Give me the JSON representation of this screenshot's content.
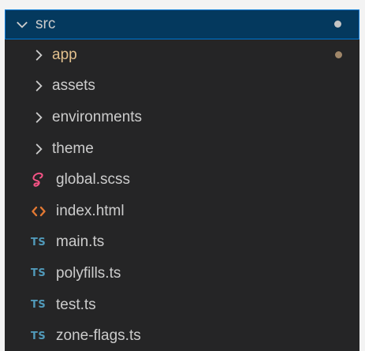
{
  "explorer": {
    "root": {
      "label": "src",
      "expanded": true,
      "status_dot_color": "#c5c5c5",
      "chevron_icon": "chevron-down-icon"
    },
    "items": [
      {
        "label": "app",
        "kind": "folder",
        "modified": true,
        "status_dot_color": "#a08769",
        "label_color": "#e2c08d",
        "icon": "chevron-right-icon"
      },
      {
        "label": "assets",
        "kind": "folder",
        "icon": "chevron-right-icon"
      },
      {
        "label": "environments",
        "kind": "folder",
        "icon": "chevron-right-icon"
      },
      {
        "label": "theme",
        "kind": "folder",
        "icon": "chevron-right-icon"
      },
      {
        "label": "global.scss",
        "kind": "file",
        "icon": "sass-file-icon",
        "icon_color": "#f55385"
      },
      {
        "label": "index.html",
        "kind": "file",
        "icon": "html-file-icon",
        "icon_color": "#e37933"
      },
      {
        "label": "main.ts",
        "kind": "file",
        "icon": "typescript-file-icon",
        "icon_text": "TS",
        "icon_color": "#519aba"
      },
      {
        "label": "polyfills.ts",
        "kind": "file",
        "icon": "typescript-file-icon",
        "icon_text": "TS",
        "icon_color": "#519aba"
      },
      {
        "label": "test.ts",
        "kind": "file",
        "icon": "typescript-file-icon",
        "icon_text": "TS",
        "icon_color": "#519aba"
      },
      {
        "label": "zone-flags.ts",
        "kind": "file",
        "icon": "typescript-file-icon",
        "icon_text": "TS",
        "icon_color": "#519aba"
      }
    ],
    "colors": {
      "background": "#252526",
      "selected_background": "#04395e",
      "selected_border": "#0078d4",
      "text": "#cccccc"
    }
  }
}
